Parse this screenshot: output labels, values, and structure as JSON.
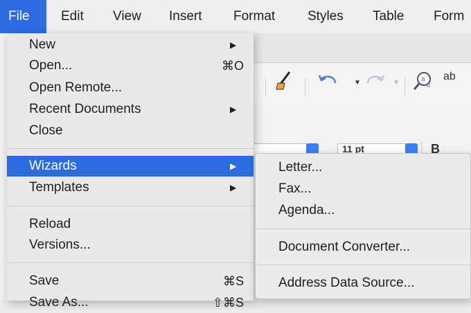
{
  "menubar": {
    "items": [
      {
        "label": "File",
        "active": true
      },
      {
        "label": "Edit"
      },
      {
        "label": "View"
      },
      {
        "label": "Insert"
      },
      {
        "label": "Format"
      },
      {
        "label": "Styles"
      },
      {
        "label": "Table"
      },
      {
        "label": "Form"
      }
    ]
  },
  "file_menu": {
    "items": [
      {
        "label": "New",
        "submenu": true
      },
      {
        "label": "Open...",
        "shortcut": "⌘O"
      },
      {
        "label": "Open Remote..."
      },
      {
        "label": "Recent Documents",
        "submenu": true
      },
      {
        "label": "Close"
      },
      {
        "label": "Wizards",
        "submenu": true,
        "highlighted": true
      },
      {
        "label": "Templates",
        "submenu": true
      },
      {
        "label": "Reload"
      },
      {
        "label": "Versions..."
      },
      {
        "label": "Save",
        "shortcut": "⌘S"
      },
      {
        "label": "Save As...",
        "shortcut": "⇧⌘S"
      }
    ]
  },
  "wizards_submenu": {
    "items": [
      {
        "label": "Letter..."
      },
      {
        "label": "Fax..."
      },
      {
        "label": "Agenda..."
      },
      {
        "label": "Document Converter..."
      },
      {
        "label": "Address Data Source..."
      }
    ]
  },
  "toolbar": {
    "font_size_value": "11 pt",
    "bold_label": "B",
    "find_replace_text": "ab"
  },
  "colors": {
    "accent": "#2d6ce0",
    "menu_bg": "#e9e9e9",
    "menubar_bg": "#efefef",
    "toolbar_icon": "#5a7dc2"
  }
}
